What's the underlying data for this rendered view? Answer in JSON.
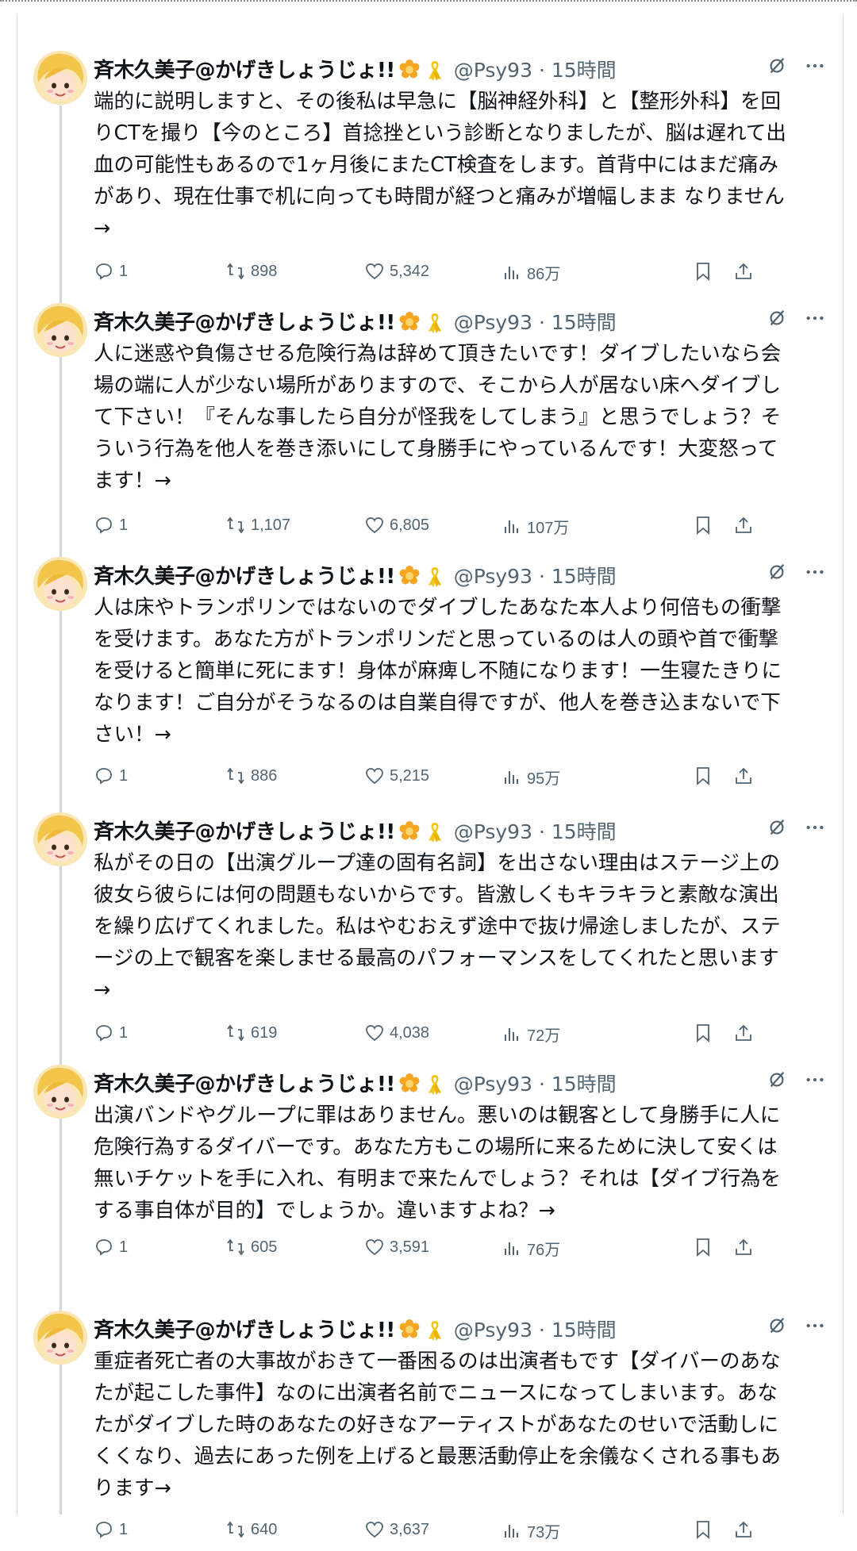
{
  "author": {
    "name": "斉木久美子@かげきしょうじょ!!",
    "handle": "@Psy93",
    "time": "15時間",
    "separator": "·"
  },
  "icons": {
    "badge1": "flower-badge-icon",
    "badge2": "awareness-ribbon-icon",
    "grok": "grok-slash-icon",
    "more": "more-options-icon",
    "reply": "reply-icon",
    "retweet": "retweet-icon",
    "like": "heart-icon",
    "views": "views-bar-chart-icon",
    "bookmark": "bookmark-icon",
    "share": "share-icon"
  },
  "colors": {
    "text": "#0f1419",
    "muted": "#536471",
    "border": "#cfd9de",
    "ribbon": "#f5c518",
    "flower": "#f5a623"
  },
  "tweets": [
    {
      "text": "端的に説明しますと、その後私は早急に【脳神経外科】と【整形外科】を回\nりCTを撮り【今のところ】首捻挫という診断となりましたが、脳は遅れて出\n血の可能性もあるので1ヶ月後にまたCT検査をします。首背中にはまだ痛み\nがあり、現在仕事で机に向っても時間が経つと痛みが増幅しまま なりません\n→",
      "replies": "1",
      "retweets": "898",
      "likes": "5,342",
      "views": "86万"
    },
    {
      "text": "人に迷惑や負傷させる危険行為は辞めて頂きたいです！ダイブしたいなら会\n場の端に人が少ない場所がありますので、そこから人が居ない床へダイブし\nて下さい！『そんな事したら自分が怪我をしてしまう』と思うでしょう？そ\nういう行為を他人を巻き添いにして身勝手にやっているんです！大変怒って\nます！→",
      "replies": "1",
      "retweets": "1,107",
      "likes": "6,805",
      "views": "107万"
    },
    {
      "text": "人は床やトランポリンではないのでダイブしたあなた本人より何倍もの衝撃\nを受けます。あなた方がトランポリンだと思っているのは人の頭や首で衝撃\nを受けると簡単に死にます！身体が麻痺し不随になります！一生寝たきりに\nなります！ご自分がそうなるのは自業自得ですが、他人を巻き込まないで下\nさい！→",
      "replies": "1",
      "retweets": "886",
      "likes": "5,215",
      "views": "95万"
    },
    {
      "text": "私がその日の【出演グループ達の固有名詞】を出さない理由はステージ上の\n彼女ら彼らには何の問題もないからです。皆激しくもキラキラと素敵な演出\nを繰り広げてくれました。私はやむおえず途中で抜け帰途しましたが、ステ\nージの上で観客を楽しませる最高のパフォーマンスをしてくれたと思います\n→",
      "replies": "1",
      "retweets": "619",
      "likes": "4,038",
      "views": "72万"
    },
    {
      "text": "出演バンドやグループに罪はありません。悪いのは観客として身勝手に人に\n危険行為するダイバーです。あなた方もこの場所に来るために決して安くは\n無いチケットを手に入れ、有明まで来たんでしょう？それは【ダイブ行為を\nする事自体が目的】でしょうか。違いますよね？→",
      "replies": "1",
      "retweets": "605",
      "likes": "3,591",
      "views": "76万"
    },
    {
      "text": "重症者死亡者の大事故がおきて一番困るのは出演者もです【ダイバーのあな\nたが起こした事件】なのに出演者名前でニュースになってしまいます。あな\nたがダイブした時のあなたの好きなアーティストがあなたのせいで活動しに\nくくなり、過去にあった例を上げると最悪活動停止を余儀なくされる事もあ\nります→",
      "replies": "1",
      "retweets": "640",
      "likes": "3,637",
      "views": "73万"
    }
  ]
}
